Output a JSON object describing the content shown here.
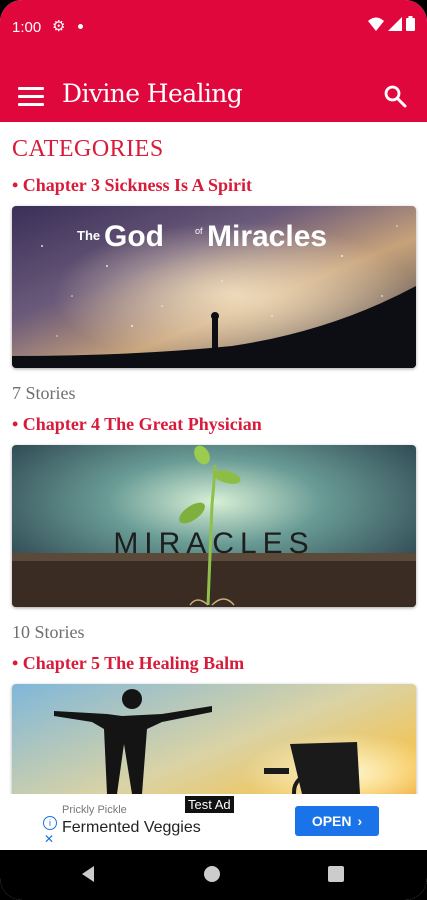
{
  "status_bar": {
    "time": "1:00"
  },
  "app_bar": {
    "title": "Divine Healing"
  },
  "content": {
    "heading": "CATEGORIES",
    "categories": [
      {
        "title": "• Chapter 3 Sickness Is A Spirit",
        "image_text": [
          "The",
          "God",
          "of",
          "Miracles"
        ],
        "stories": "7 Stories"
      },
      {
        "title": "• Chapter 4 The Great Physician",
        "image_text": [
          "MIRACLES"
        ],
        "stories": "10 Stories"
      },
      {
        "title": "• Chapter 5 The Healing Balm",
        "image_text": [],
        "stories": ""
      }
    ]
  },
  "ad": {
    "advertiser": "Prickly Pickle",
    "product": "Fermented Veggies",
    "badge": "Test Ad",
    "cta": "OPEN",
    "close": "✕"
  },
  "colors": {
    "brand": "#e0073c",
    "chapter_text": "#d81b3a",
    "cta": "#1a73e8"
  }
}
